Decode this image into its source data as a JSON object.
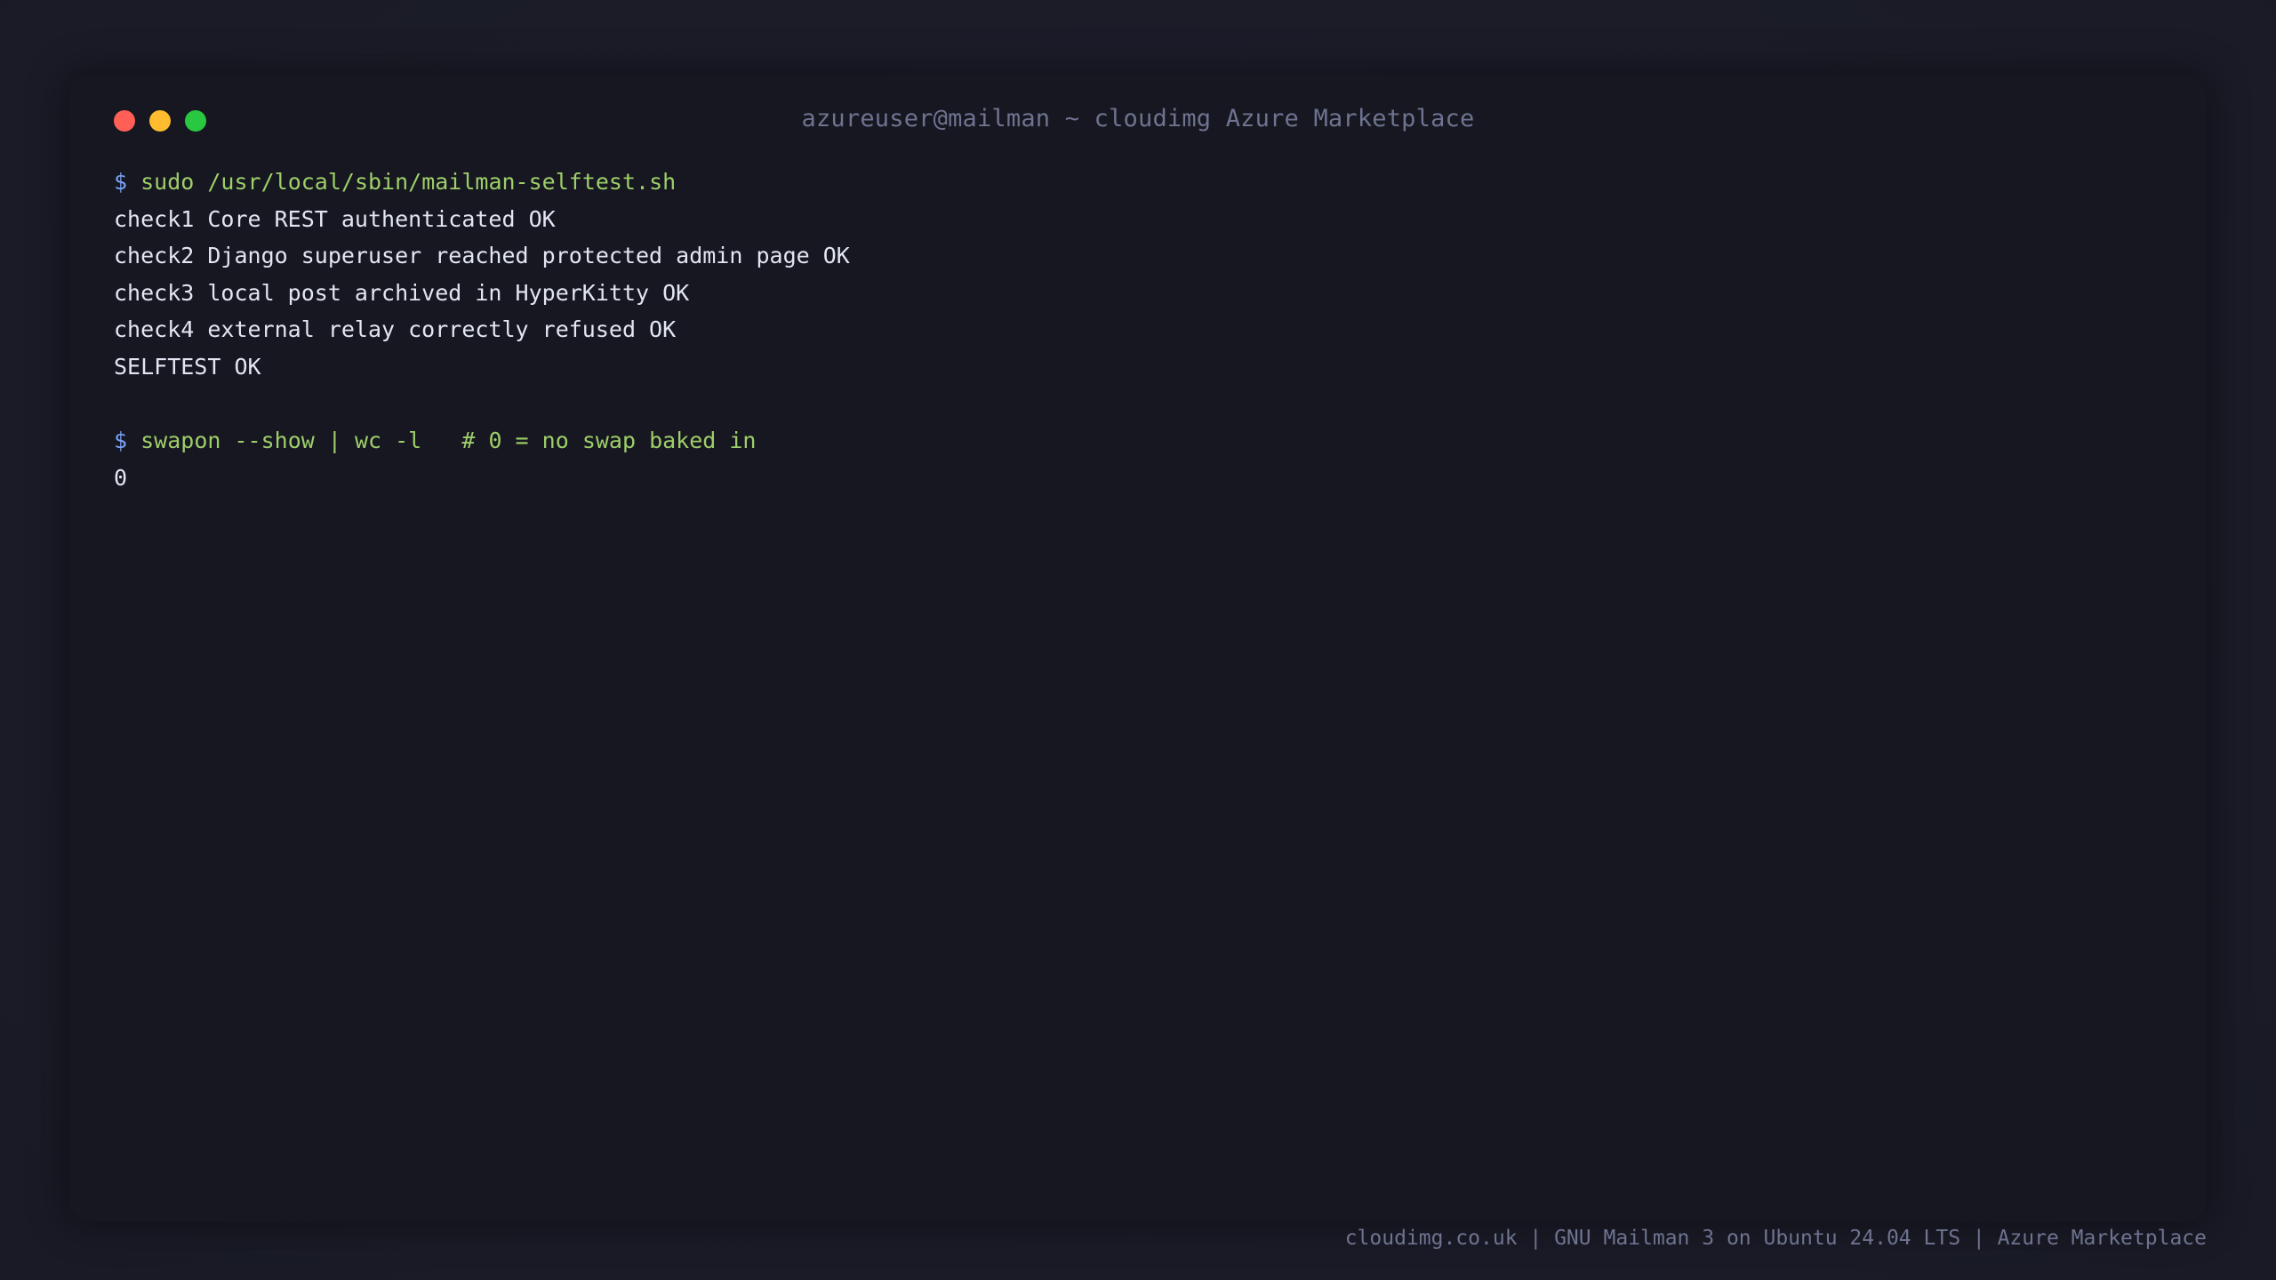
{
  "window": {
    "title": "azureuser@mailman ~ cloudimg Azure Marketplace"
  },
  "terminal": {
    "prompt_symbol": "$",
    "command1": "sudo /usr/local/sbin/mailman-selftest.sh",
    "output1": [
      "check1 Core REST authenticated OK",
      "check2 Django superuser reached protected admin page OK",
      "check3 local post archived in HyperKitty OK",
      "check4 external relay correctly refused OK",
      "SELFTEST OK"
    ],
    "command2": "swapon --show | wc -l   # 0 = no swap baked in",
    "output2": "0"
  },
  "footer": {
    "text": "cloudimg.co.uk | GNU Mailman 3 on Ubuntu 24.04 LTS | Azure Marketplace"
  },
  "colors": {
    "background": "#1b1c28",
    "terminal_bg": "#161720",
    "prompt": "#7aa2f7",
    "command": "#9ece6a",
    "output": "#e2e5f2",
    "muted": "#6e7390",
    "close": "#ff5f57",
    "minimize": "#febc2e",
    "maximize": "#28c840"
  }
}
